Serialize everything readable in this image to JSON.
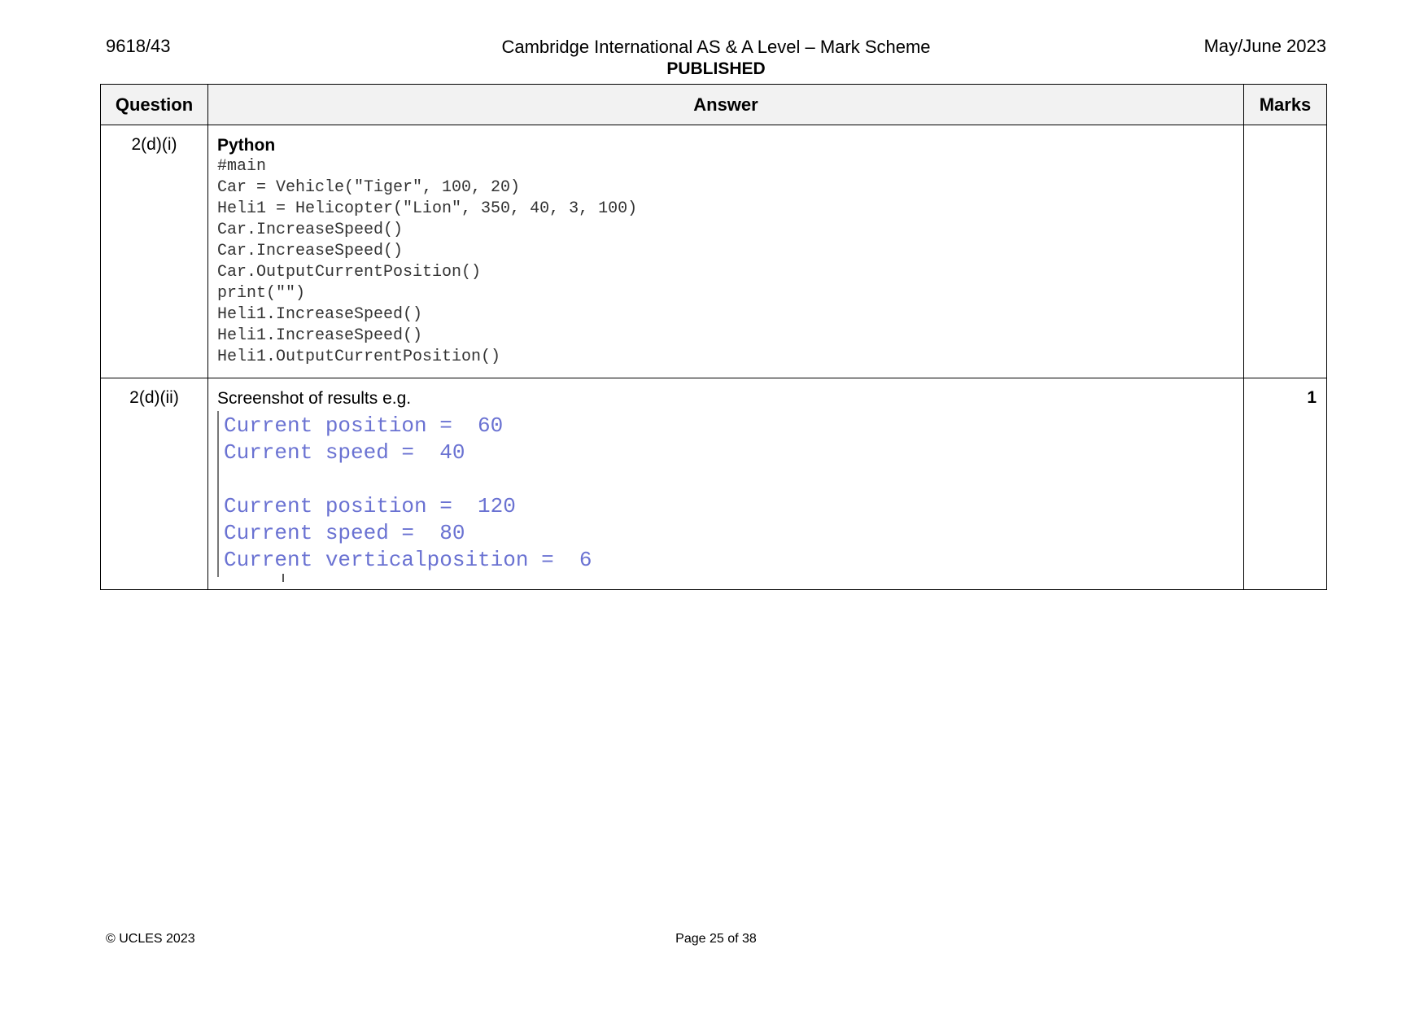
{
  "header": {
    "code": "9618/43",
    "title": "Cambridge International AS & A Level – Mark Scheme",
    "status": "PUBLISHED",
    "session": "May/June 2023"
  },
  "table": {
    "headers": {
      "question": "Question",
      "answer": "Answer",
      "marks": "Marks"
    },
    "rows": [
      {
        "question": "2(d)(i)",
        "language": "Python",
        "code": "#main\nCar = Vehicle(\"Tiger\", 100, 20)\nHeli1 = Helicopter(\"Lion\", 350, 40, 3, 100)\nCar.IncreaseSpeed()\nCar.IncreaseSpeed()\nCar.OutputCurrentPosition()\nprint(\"\")\nHeli1.IncreaseSpeed()\nHeli1.IncreaseSpeed()\nHeli1.OutputCurrentPosition()",
        "marks": ""
      },
      {
        "question": "2(d)(ii)",
        "intro": "Screenshot of results e.g.",
        "output_lines": [
          "Current position =  60",
          "Current speed =  40",
          "",
          "Current position =  120",
          "Current speed =  80",
          "Current verticalposition =  6"
        ],
        "marks": "1"
      }
    ]
  },
  "footer": {
    "copyright": "© UCLES 2023",
    "page": "Page 25 of 38"
  }
}
